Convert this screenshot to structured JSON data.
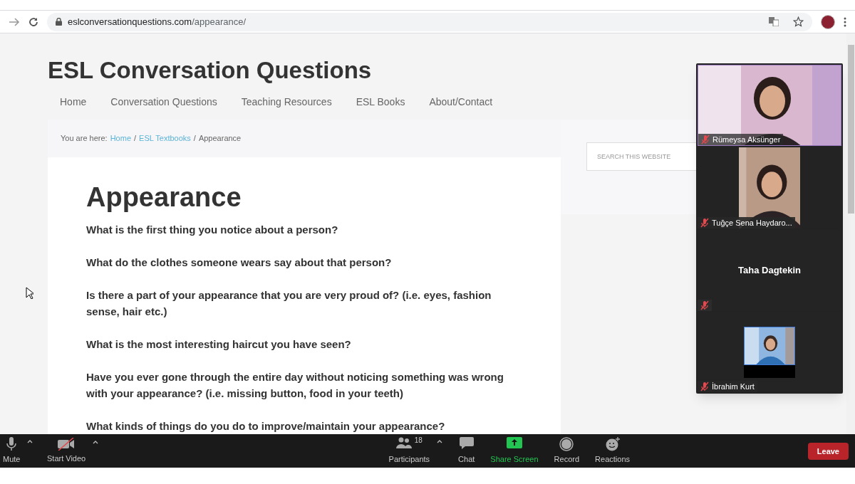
{
  "browser": {
    "url_host": "eslconversationquestions.com",
    "url_path": "/appearance/"
  },
  "site": {
    "title": "ESL Conversation Questions",
    "nav": [
      {
        "label": "Home"
      },
      {
        "label": "Conversation Questions"
      },
      {
        "label": "Teaching Resources"
      },
      {
        "label": "ESL Books"
      },
      {
        "label": "About/Contact"
      }
    ],
    "breadcrumb": [
      {
        "text": "You are here:",
        "kind": "label"
      },
      {
        "text": "Home",
        "kind": "link"
      },
      {
        "text": "/",
        "kind": "separator"
      },
      {
        "text": "ESL Textbooks",
        "kind": "link"
      },
      {
        "text": "/",
        "kind": "separator"
      },
      {
        "text": "Appearance",
        "kind": "current"
      }
    ],
    "search": {
      "placeholder": "SEARCH THIS WEBSITE"
    }
  },
  "article": {
    "heading": "Appearance",
    "questions": [
      "What is the first thing you notice about a person?",
      "What do the clothes someone wears say about that person?",
      "Is there a part of your appearance that you are very proud of? (i.e. eyes, fashion sense, hair etc.)",
      "What is the most interesting haircut you have seen?",
      "Have you ever gone through the entire day without noticing something was wrong with your appearance? (i.e. missing button, food in your teeth)",
      "What kinds of things do you do to improve/maintain your appearance?"
    ]
  },
  "video_panel": {
    "participants": [
      {
        "name": "Rümeysa Aksünger",
        "kind": "wide_video",
        "muted": true
      },
      {
        "name": "Tuğçe Sena Haydaro...",
        "kind": "video",
        "muted": true
      },
      {
        "name": "Taha Dagtekin",
        "kind": "name_only",
        "muted": true
      },
      {
        "name": "İbrahim Kurt",
        "kind": "small_video",
        "muted": true
      }
    ]
  },
  "meeting_toolbar": {
    "left": [
      {
        "label": "Mute",
        "kind": "mic"
      },
      {
        "label": "Start Video",
        "kind": "video_off"
      }
    ],
    "center": [
      {
        "label": "Participants",
        "kind": "participants",
        "count": "18"
      },
      {
        "label": "Chat",
        "kind": "chat"
      },
      {
        "label": "Share Screen",
        "kind": "share"
      },
      {
        "label": "Record",
        "kind": "record"
      },
      {
        "label": "Reactions",
        "kind": "reactions"
      }
    ],
    "leave": "Leave"
  }
}
